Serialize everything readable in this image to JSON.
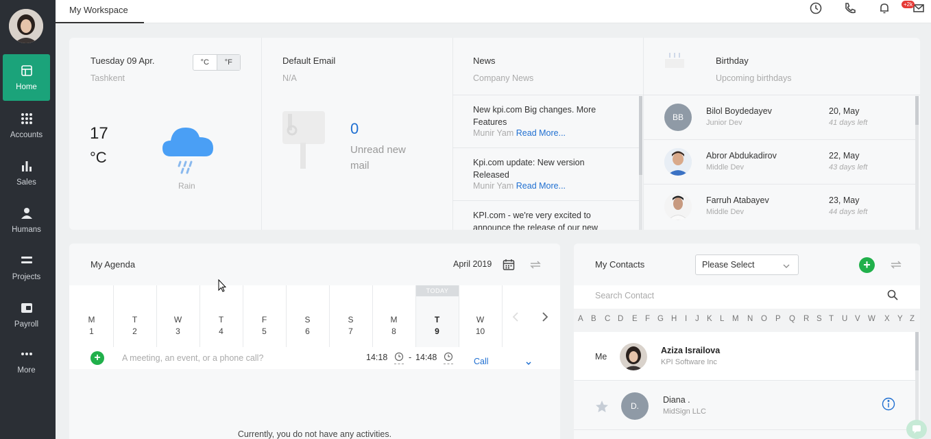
{
  "sidebar": {
    "items": [
      {
        "label": "Home",
        "icon": "home-icon"
      },
      {
        "label": "Accounts",
        "icon": "grid-icon"
      },
      {
        "label": "Sales",
        "icon": "bar-chart-icon"
      },
      {
        "label": "Humans",
        "icon": "person-icon"
      },
      {
        "label": "Projects",
        "icon": "layers-icon"
      },
      {
        "label": "Payroll",
        "icon": "wallet-icon"
      },
      {
        "label": "More",
        "icon": "dots-icon"
      }
    ]
  },
  "topbar": {
    "tab": "My Workspace",
    "badge": "+2k"
  },
  "weather": {
    "date": "Tuesday 09 Apr.",
    "city": "Tashkent",
    "temp": "17",
    "unit": "°C",
    "condition": "Rain",
    "unit_c": "°C",
    "unit_f": "°F"
  },
  "email": {
    "title": "Default Email",
    "value": "N/A",
    "count": "0",
    "unread_line1": "Unread new",
    "unread_line2": "mail"
  },
  "news": {
    "title": "News",
    "subtitle": "Company News",
    "items": [
      {
        "title": "New kpi.com Big changes. More Features",
        "author": "Munir Yam",
        "more": "Read More..."
      },
      {
        "title": "Kpi.com update: New version Released",
        "author": "Munir Yam",
        "more": "Read More..."
      },
      {
        "title": "KPI.com - we're very excited to announce the release of our new"
      }
    ]
  },
  "birthday": {
    "title": "Birthday",
    "subtitle": "Upcoming birthdays",
    "items": [
      {
        "initials": "BB",
        "name": "Bilol Boydedayev",
        "role": "Junior Dev",
        "date": "20, May",
        "left": "41 days left"
      },
      {
        "initials": "",
        "name": "Abror Abdukadirov",
        "role": "Middle Dev",
        "date": "22, May",
        "left": "43 days left"
      },
      {
        "initials": "",
        "name": "Farruh Atabayev",
        "role": "Middle Dev",
        "date": "23, May",
        "left": "44 days left"
      }
    ]
  },
  "agenda": {
    "title": "My Agenda",
    "month": "April 2019",
    "today_label": "TODAY",
    "days": [
      {
        "d": "M",
        "n": "1"
      },
      {
        "d": "T",
        "n": "2"
      },
      {
        "d": "W",
        "n": "3"
      },
      {
        "d": "T",
        "n": "4"
      },
      {
        "d": "F",
        "n": "5"
      },
      {
        "d": "S",
        "n": "6"
      },
      {
        "d": "S",
        "n": "7"
      },
      {
        "d": "M",
        "n": "8"
      },
      {
        "d": "T",
        "n": "9"
      },
      {
        "d": "W",
        "n": "10"
      }
    ],
    "placeholder": "A meeting, an event, or a phone call?",
    "time_from": "14:18",
    "dash": "-",
    "time_to": "14:48",
    "type": "Call",
    "empty": "Currently, you do not have any activities."
  },
  "contacts": {
    "title": "My Contacts",
    "select": "Please Select",
    "search_placeholder": "Search Contact",
    "letters": [
      "A",
      "B",
      "C",
      "D",
      "E",
      "F",
      "G",
      "H",
      "I",
      "J",
      "K",
      "L",
      "M",
      "N",
      "O",
      "P",
      "Q",
      "R",
      "S",
      "T",
      "U",
      "V",
      "W",
      "X",
      "Y",
      "Z"
    ],
    "me_label": "Me",
    "items": [
      {
        "name": "Aziza Israilova",
        "company": "KPI Software Inc"
      },
      {
        "initials": "D.",
        "name": "Diana .",
        "company": "MidSign LLC"
      }
    ]
  }
}
